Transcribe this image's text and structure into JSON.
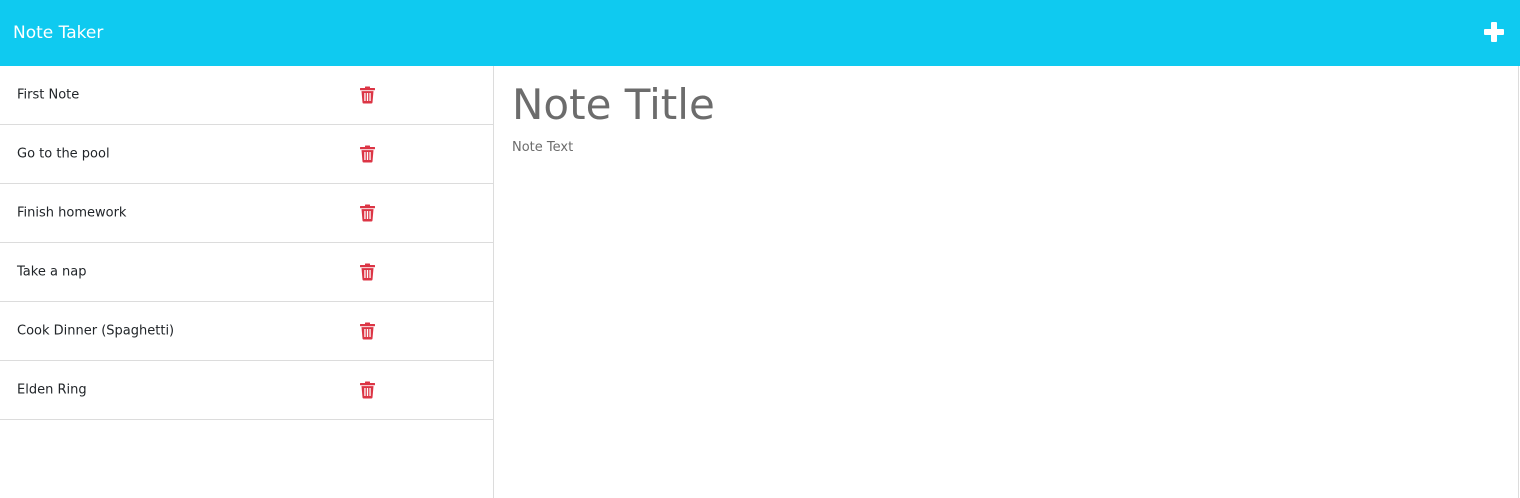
{
  "navbar": {
    "brand": "Note Taker",
    "new_note_icon": "plus-icon"
  },
  "notes": [
    {
      "title": "First Note",
      "delete_icon": "trash-icon"
    },
    {
      "title": "Go to the pool",
      "delete_icon": "trash-icon"
    },
    {
      "title": "Finish homework",
      "delete_icon": "trash-icon"
    },
    {
      "title": "Take a nap",
      "delete_icon": "trash-icon"
    },
    {
      "title": "Cook Dinner (Spaghetti)",
      "delete_icon": "trash-icon"
    },
    {
      "title": "Elden Ring",
      "delete_icon": "trash-icon"
    }
  ],
  "editor": {
    "title_value": "",
    "title_placeholder": "Note Title",
    "text_value": "",
    "text_placeholder": "Note Text"
  },
  "colors": {
    "navbar": "#0fcaf0",
    "delete": "#dc3545",
    "placeholder": "#6c6c6c"
  }
}
